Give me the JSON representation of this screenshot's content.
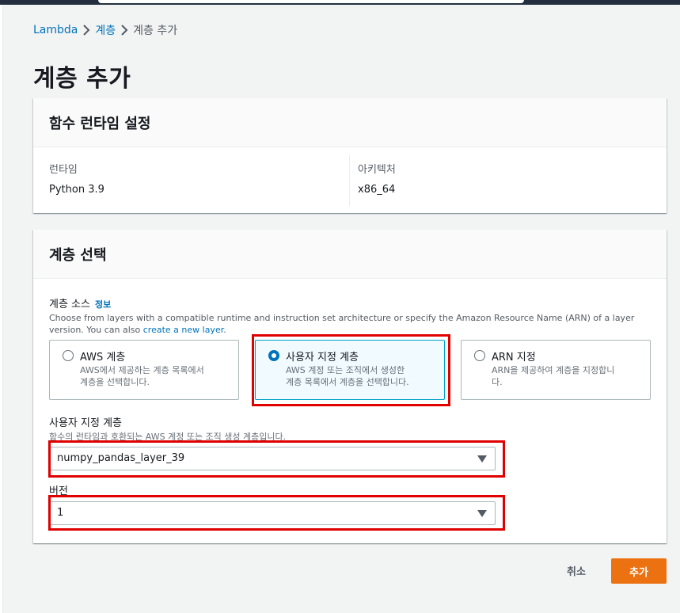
{
  "breadcrumb": {
    "root": "Lambda",
    "parent": "계층",
    "current": "계층 추가"
  },
  "page_title": "계층 추가",
  "runtime_panel": {
    "title": "함수 런타임 설정",
    "runtime_label": "런타임",
    "runtime_value": "Python 3.9",
    "arch_label": "아키텍처",
    "arch_value": "x86_64"
  },
  "layer_panel": {
    "title": "계층 선택",
    "source_label": "계층 소스",
    "info_link": "정보",
    "description_prefix": "Choose from layers with a compatible runtime and instruction set architecture or specify the Amazon Resource Name (ARN) of a layer version. You can also ",
    "description_link": "create a new layer",
    "description_suffix": ".",
    "options": [
      {
        "title": "AWS 계층",
        "line1": "AWS에서 제공하는 계층 목록에서",
        "line2": "계층을 선택합니다.",
        "selected": false
      },
      {
        "title": "사용자 지정 계층",
        "line1": "AWS 계정 또는 조직에서 생성한",
        "line2": "계층 목록에서 계층을 선택합니다.",
        "selected": true
      },
      {
        "title": "ARN 지정",
        "line1": "ARN을 제공하여 계층을 지정합니",
        "line2": "다.",
        "selected": false
      }
    ],
    "custom_layer_label": "사용자 지정 계층",
    "custom_layer_hint": "함수의 런타임과 호환되는 AWS 계정 또는 조직 생성 계층입니다.",
    "custom_layer_value": "numpy_pandas_layer_39",
    "version_label": "버전",
    "version_value": "1"
  },
  "actions": {
    "cancel": "취소",
    "add": "추가"
  },
  "colors": {
    "accent": "#ec7211",
    "link": "#0073bb",
    "highlight": "#e00000"
  }
}
